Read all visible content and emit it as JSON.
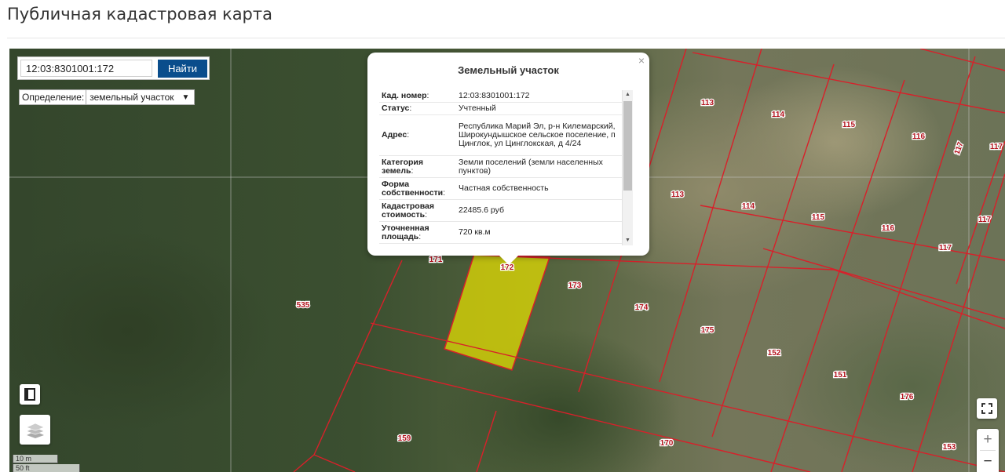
{
  "page_title": "Публичная кадастровая карта",
  "search": {
    "value": "12:03:8301001:172",
    "button_label": "Найти"
  },
  "type_select": {
    "label": "Определение:",
    "value": "земельный участок"
  },
  "popup": {
    "title": "Земельный участок",
    "close_glyph": "×",
    "rows": [
      {
        "key": "Кад. номер",
        "value": "12:03:8301001:172"
      },
      {
        "key": "Статус",
        "value": "Учтенный"
      },
      {
        "key": "Адрес",
        "value": "Республика Марий Эл, р-н Килемарский, Широкундышское сельское поселение, п Цинглок, ул Цинглокская, д 4/24"
      },
      {
        "key": "Категория земель",
        "value": "Земли поселений (земли населенных пунктов)"
      },
      {
        "key": "Форма собственности",
        "value": "Частная собственность"
      },
      {
        "key": "Кадастровая стоимость",
        "value": "22485.6 руб"
      },
      {
        "key": "Уточненная площадь",
        "value": "720 кв.м"
      }
    ]
  },
  "parcel_labels": [
    "113",
    "114",
    "115",
    "116",
    "117",
    "117",
    "113",
    "114",
    "115",
    "116",
    "117",
    "117",
    "171",
    "172",
    "173",
    "174",
    "175",
    "152",
    "151",
    "176",
    "153",
    "535",
    "159",
    "170"
  ],
  "scale": {
    "line1": "10 m",
    "line2": "50 ft"
  },
  "zoom": {
    "in": "+",
    "out": "−"
  },
  "colors": {
    "boundary": "#d8202a",
    "selected_fill": "#e8e000",
    "button": "#0a4d8c"
  }
}
